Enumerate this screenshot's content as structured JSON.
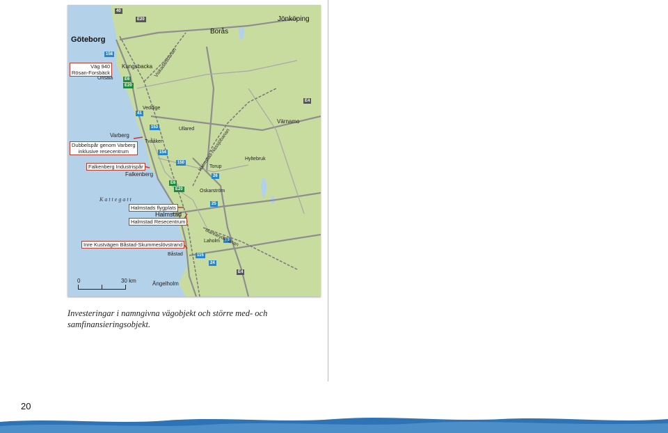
{
  "map": {
    "cities": {
      "goteborg": "Göteborg",
      "boras": "Borås",
      "jonkoping": "Jönköping",
      "kungsbacka": "Kungsbacka",
      "onsala": "Onsala",
      "veddige": "Veddige",
      "varberg": "Varberg",
      "tvaaker": "Tvååker",
      "ullared": "Ullared",
      "varnamo": "Värnamo",
      "hyltebruk": "Hyltebruk",
      "torup": "Torup",
      "falkenberg": "Falkenberg",
      "oskarstrom": "Oskarström",
      "halmstad": "Halmstad",
      "laholm": "Laholm",
      "bastad": "Båstad",
      "angelholm": "Ängelholm"
    },
    "sea_label": "Kattegatt",
    "rail_lines": {
      "viskadalsbanan": "Viskadalsbanan",
      "halmstad_nassjobanan": "Halmstad-Nässjöbanan",
      "markarydsbanan": "Markarydsbanan"
    },
    "projects": {
      "vag940_line1": "Väg 940",
      "vag940_line2": "Rösan-Forsbäck",
      "dubbelspar_line1": "Dubbelspår genom Varberg",
      "dubbelspar_line2": "inklusive resecentrum",
      "falkenberg_industrispar": "Falkenberg Industrispår",
      "halmstads_flygplats": "Halmstads flygplats",
      "halmstad_resecentrum": "Halmstad Resecentrum",
      "inre_kustvagen": "Inre Kustvägen Båstad-Skummeslövstrand"
    },
    "road_shields": {
      "r40": "40",
      "e20_top": "E20",
      "r158": "158",
      "e6_a": "E6",
      "e20_a": "E20",
      "r41": "41",
      "e4_top": "E4",
      "r153": "153",
      "r154": "154",
      "r150": "150",
      "r26": "26",
      "e6_b": "E6",
      "e20_b": "E20",
      "r25": "25",
      "r15": "15",
      "r115": "115",
      "r24": "24",
      "e4_bottom": "E4"
    },
    "scale": {
      "zero": "0",
      "end": "30 km"
    },
    "colors": {
      "land": "#c9dca0",
      "sea": "#b4d1ea",
      "road": "#8e8e8e",
      "project": "#c0392b"
    }
  },
  "caption": "Investeringar i namngivna vägobjekt och större med- och samfinansieringsobjekt.",
  "page_number": "20"
}
